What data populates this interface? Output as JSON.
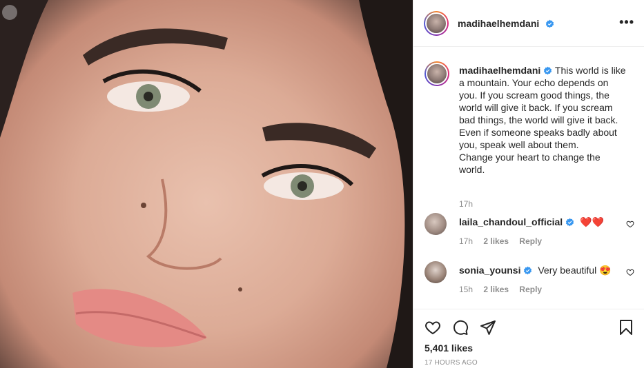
{
  "post": {
    "username": "madihaelhemdani",
    "caption_lines": [
      "This world is like",
      "a mountain. Your echo depends on",
      "you. If you scream good things, the",
      "world will give it back. If you scream",
      "bad things, the world will give it back.",
      "Even if someone speaks badly about",
      "you, speak well about them.",
      "Change your heart to change the",
      "world."
    ],
    "caption_time": "17h",
    "likes": "5,401 likes",
    "timestamp": "17 HOURS AGO"
  },
  "comments": [
    {
      "username": "laila_chandoul_official",
      "text": "❤️❤️",
      "time": "17h",
      "likes": "2 likes",
      "reply": "Reply"
    },
    {
      "username": "sonia_younsi",
      "text": "Very beautiful 😍",
      "time": "15h",
      "likes": "2 likes",
      "reply": "Reply"
    }
  ],
  "icons": {
    "more": "more-options-icon",
    "verified": "verified-badge-icon",
    "like": "heart-icon",
    "comment": "comment-icon",
    "share": "paper-plane-icon",
    "save": "bookmark-icon"
  },
  "colors": {
    "verified": "#3897f0",
    "text": "#262626",
    "muted": "#8e8e8e",
    "heart_emoji": "#e0182d"
  }
}
